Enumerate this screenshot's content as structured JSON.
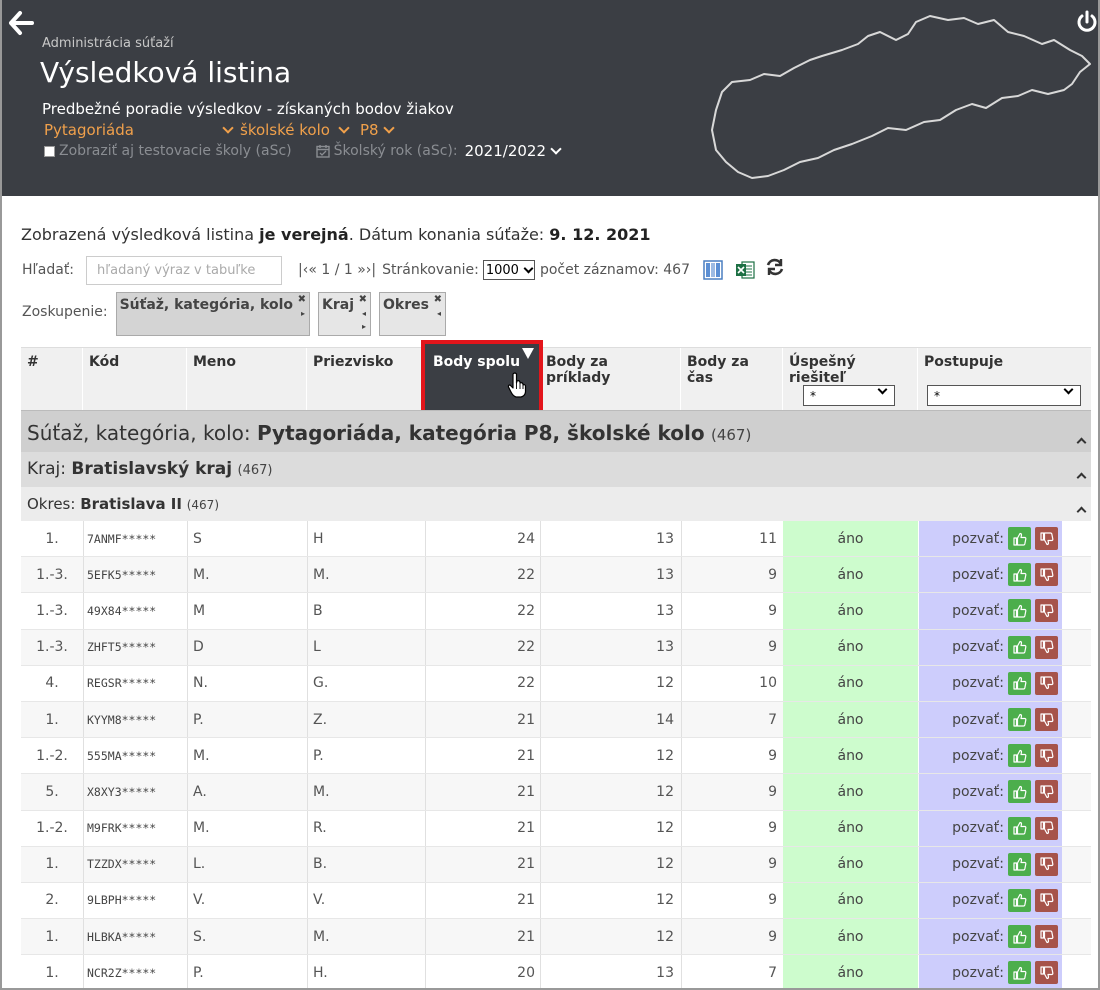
{
  "header": {
    "breadcrumb": "Administrácia súťaží",
    "title": "Výsledková listina",
    "subtitle": "Predbežné poradie výsledkov - získaných bodov žiakov",
    "competition": "Pytagoriáda",
    "round": "školské kolo",
    "category": "P8",
    "test_schools_label": "Zobraziť aj testovacie školy (aSc)",
    "school_year_label": "Školský rok (aSc):",
    "school_year": "2021/2022"
  },
  "info": {
    "prefix": "Zobrazená výsledková listina ",
    "public": "je verejná",
    "date_label": ". Dátum konania súťaže: ",
    "date": "9. 12. 2021"
  },
  "toolbar": {
    "search_label": "Hľadať:",
    "search_placeholder": "hľadaný výraz v tabuľke",
    "pager": "|‹« 1 / 1 »›|",
    "paging_label": "Stránkovanie:",
    "paging_value": "1000",
    "count_label": "počet záznamov: 467"
  },
  "grouping": {
    "label": "Zoskupenie:",
    "chips": [
      "Súťaž, kategória, kolo",
      "Kraj",
      "Okres"
    ]
  },
  "table": {
    "headers": {
      "rank": "#",
      "kod": "Kód",
      "meno": "Meno",
      "priezvisko": "Priezvisko",
      "body_spolu": "Body spolu",
      "body_priklady": "Body za príklady",
      "body_cas": "Body za čas",
      "uspesny": "Úspešný riešiteľ",
      "postupuje": "Postupuje"
    },
    "filter_uspesny": "*",
    "filter_postupuje": "*",
    "group1": {
      "label": "Súťaž, kategória, kolo: ",
      "value": "Pytagoriáda, kategória P8, školské kolo",
      "count": "(467)"
    },
    "group2": {
      "label": "Kraj: ",
      "value": "Bratislavský kraj",
      "count": "(467)"
    },
    "group3": {
      "label": "Okres: ",
      "value": "Bratislava II",
      "count": "(467)"
    },
    "invite_label": "pozvať:",
    "rows": [
      {
        "rank": "1.",
        "kod": "7ANMF*****",
        "meno": "S",
        "priezvisko": "H",
        "body": "24",
        "prik": "13",
        "cas": "11",
        "usp": "áno"
      },
      {
        "rank": "1.-3.",
        "kod": "5EFK5*****",
        "meno": "M.",
        "priezvisko": "M.",
        "body": "22",
        "prik": "13",
        "cas": "9",
        "usp": "áno"
      },
      {
        "rank": "1.-3.",
        "kod": "49X84*****",
        "meno": "M",
        "priezvisko": "B",
        "body": "22",
        "prik": "13",
        "cas": "9",
        "usp": "áno"
      },
      {
        "rank": "1.-3.",
        "kod": "ZHFT5*****",
        "meno": "D",
        "priezvisko": "L",
        "body": "22",
        "prik": "13",
        "cas": "9",
        "usp": "áno"
      },
      {
        "rank": "4.",
        "kod": "REGSR*****",
        "meno": "N.",
        "priezvisko": "G.",
        "body": "22",
        "prik": "12",
        "cas": "10",
        "usp": "áno"
      },
      {
        "rank": "1.",
        "kod": "KYYM8*****",
        "meno": "P.",
        "priezvisko": "Z.",
        "body": "21",
        "prik": "14",
        "cas": "7",
        "usp": "áno"
      },
      {
        "rank": "1.-2.",
        "kod": "555MA*****",
        "meno": "M.",
        "priezvisko": "P.",
        "body": "21",
        "prik": "12",
        "cas": "9",
        "usp": "áno"
      },
      {
        "rank": "5.",
        "kod": "X8XY3*****",
        "meno": "A.",
        "priezvisko": "M.",
        "body": "21",
        "prik": "12",
        "cas": "9",
        "usp": "áno"
      },
      {
        "rank": "1.-2.",
        "kod": "M9FRK*****",
        "meno": "M.",
        "priezvisko": "R.",
        "body": "21",
        "prik": "12",
        "cas": "9",
        "usp": "áno"
      },
      {
        "rank": "1.",
        "kod": "TZZDX*****",
        "meno": "L.",
        "priezvisko": "B.",
        "body": "21",
        "prik": "12",
        "cas": "9",
        "usp": "áno"
      },
      {
        "rank": "2.",
        "kod": "9LBPH*****",
        "meno": "V.",
        "priezvisko": "V.",
        "body": "21",
        "prik": "12",
        "cas": "9",
        "usp": "áno"
      },
      {
        "rank": "1.",
        "kod": "HLBKA*****",
        "meno": "S.",
        "priezvisko": "M.",
        "body": "21",
        "prik": "12",
        "cas": "9",
        "usp": "áno"
      },
      {
        "rank": "1.",
        "kod": "NCR2Z*****",
        "meno": "P.",
        "priezvisko": "H.",
        "body": "20",
        "prik": "13",
        "cas": "7",
        "usp": "áno"
      }
    ]
  },
  "colors": {
    "header_bg": "#3b3e44",
    "accent_orange": "#f0a04b",
    "success_bg": "#cdfccd",
    "advance_bg": "#cdcdfc",
    "approve_btn": "#4cae4c",
    "reject_btn": "#a6534a",
    "highlight_border": "#e3151b"
  }
}
